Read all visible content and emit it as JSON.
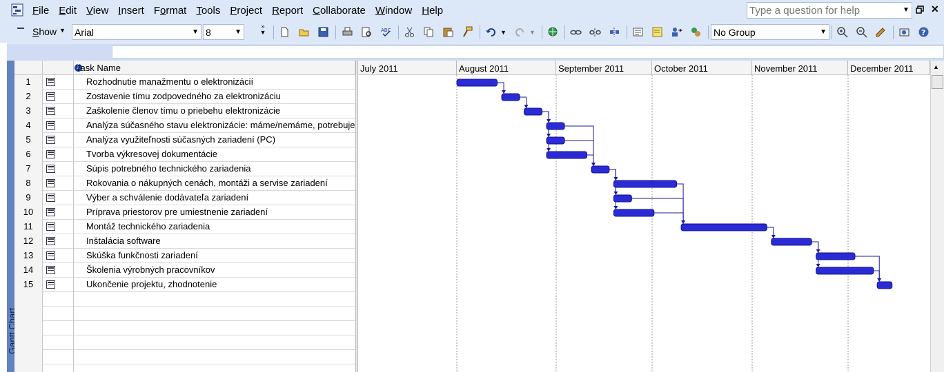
{
  "menubar": {
    "items": [
      {
        "accel": "F",
        "rest": "ile"
      },
      {
        "accel": "E",
        "rest": "dit"
      },
      {
        "accel": "V",
        "rest": "iew"
      },
      {
        "accel": "I",
        "rest": "nsert"
      },
      {
        "accel": "",
        "pre": "F",
        "accel2": "o",
        "rest": "rmat"
      },
      {
        "accel": "T",
        "rest": "ools"
      },
      {
        "accel": "P",
        "rest": "roject"
      },
      {
        "accel": "R",
        "rest": "eport"
      },
      {
        "accel": "C",
        "rest": "ollaborate"
      },
      {
        "accel": "W",
        "rest": "indow"
      },
      {
        "accel": "H",
        "rest": "elp"
      }
    ],
    "help_placeholder": "Type a question for help"
  },
  "toolbar": {
    "show_label_accel": "S",
    "show_label_rest": "how",
    "font": "Arial",
    "font_size": "8",
    "group": "No Group"
  },
  "viewbar": {
    "label": "Gantt Chart"
  },
  "grid": {
    "header_task_name": "Task Name",
    "tasks": [
      {
        "id": "1",
        "name": "Rozhodnutie manažmentu o elektronizácií"
      },
      {
        "id": "2",
        "name": "Zostavenie tímu zodpovedného za elektronizáciu"
      },
      {
        "id": "3",
        "name": "Zaškolenie členov tímu o priebehu elektronizácie"
      },
      {
        "id": "4",
        "name": "Analýza súčasného stavu elektronizácie: máme/nemáme, potrebuje"
      },
      {
        "id": "5",
        "name": "Analýza využiteľnosti súčasných zariadení (PC)"
      },
      {
        "id": "6",
        "name": "Tvorba výkresovej dokumentácie"
      },
      {
        "id": "7",
        "name": "Súpis potrebného technického zariadenia"
      },
      {
        "id": "8",
        "name": "Rokovania o nákupných cenách, montáži a servise zariadení"
      },
      {
        "id": "9",
        "name": "Výber a schválenie dodávateľa zariadení"
      },
      {
        "id": "10",
        "name": "Príprava priestorov pre umiestnenie zariadení"
      },
      {
        "id": "11",
        "name": "Montáž technického zariadenia"
      },
      {
        "id": "12",
        "name": "Inštalácia software"
      },
      {
        "id": "13",
        "name": "Skúška funkčnosti zariadení"
      },
      {
        "id": "14",
        "name": "Školenia výrobných pracovníkov"
      },
      {
        "id": "15",
        "name": "Ukončenie projektu, zhodnotenie"
      }
    ]
  },
  "gantt": {
    "months": [
      "July 2011",
      "August 2011",
      "September 2011",
      "October 2011",
      "November 2011",
      "December 2011"
    ],
    "bar_color": "#2b2bd6",
    "bar_border": "#11118f",
    "link_color": "#1a1a9a",
    "bars": [
      {
        "task": 1,
        "start": "2011-08-01",
        "end": "2011-08-13"
      },
      {
        "task": 2,
        "start": "2011-08-15",
        "end": "2011-08-20"
      },
      {
        "task": 3,
        "start": "2011-08-22",
        "end": "2011-08-27"
      },
      {
        "task": 4,
        "start": "2011-08-29",
        "end": "2011-09-03"
      },
      {
        "task": 5,
        "start": "2011-08-29",
        "end": "2011-09-03"
      },
      {
        "task": 6,
        "start": "2011-08-29",
        "end": "2011-09-10"
      },
      {
        "task": 7,
        "start": "2011-09-12",
        "end": "2011-09-17"
      },
      {
        "task": 8,
        "start": "2011-09-19",
        "end": "2011-10-08"
      },
      {
        "task": 9,
        "start": "2011-09-19",
        "end": "2011-09-24"
      },
      {
        "task": 10,
        "start": "2011-09-19",
        "end": "2011-10-01"
      },
      {
        "task": 11,
        "start": "2011-10-10",
        "end": "2011-11-05"
      },
      {
        "task": 12,
        "start": "2011-11-07",
        "end": "2011-11-19"
      },
      {
        "task": 13,
        "start": "2011-11-21",
        "end": "2011-12-03"
      },
      {
        "task": 14,
        "start": "2011-11-21",
        "end": "2011-12-10"
      },
      {
        "task": 15,
        "start": "2011-12-12",
        "end": "2011-12-17"
      }
    ],
    "links": [
      [
        1,
        2
      ],
      [
        2,
        3
      ],
      [
        3,
        4
      ],
      [
        3,
        5
      ],
      [
        3,
        6
      ],
      [
        4,
        7
      ],
      [
        5,
        7
      ],
      [
        6,
        7
      ],
      [
        7,
        8
      ],
      [
        7,
        9
      ],
      [
        7,
        10
      ],
      [
        8,
        11
      ],
      [
        9,
        11
      ],
      [
        10,
        11
      ],
      [
        11,
        12
      ],
      [
        12,
        13
      ],
      [
        12,
        14
      ],
      [
        13,
        15
      ],
      [
        14,
        15
      ]
    ]
  }
}
